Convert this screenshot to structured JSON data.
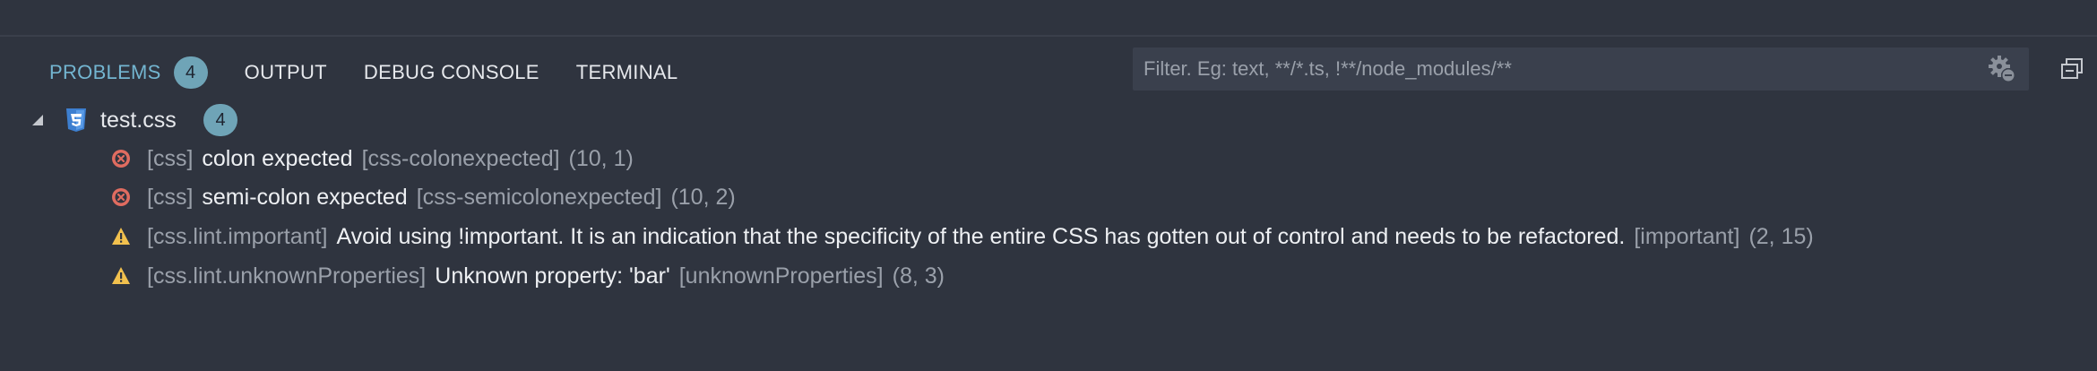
{
  "tabs": [
    {
      "label": "PROBLEMS",
      "badge": "4",
      "active": true
    },
    {
      "label": "OUTPUT"
    },
    {
      "label": "DEBUG CONSOLE"
    },
    {
      "label": "TERMINAL"
    }
  ],
  "filter": {
    "placeholder": "Filter. Eg: text, **/*.ts, !**/node_modules/**",
    "value": ""
  },
  "file": {
    "name": "test.css",
    "count": "4"
  },
  "problems": [
    {
      "severity": "error",
      "source": "[css]",
      "message": "colon expected",
      "code": "[css-colonexpected]",
      "position": "(10, 1)"
    },
    {
      "severity": "error",
      "source": "[css]",
      "message": "semi-colon expected",
      "code": "[css-semicolonexpected]",
      "position": "(10, 2)"
    },
    {
      "severity": "warning",
      "source": "[css.lint.important]",
      "message": "Avoid using !important. It is an indication that the specificity of the entire CSS has gotten out of control and needs to be refactored.",
      "code": "[important]",
      "position": "(2, 15)"
    },
    {
      "severity": "warning",
      "source": "[css.lint.unknownProperties]",
      "message": "Unknown property: 'bar'",
      "code": "[unknownProperties]",
      "position": "(8, 3)"
    }
  ],
  "colors": {
    "background": "#2f343f",
    "active_tab": "#73b5d0",
    "badge": "#6fa4b7",
    "error": "#e06c60",
    "warning": "#f2c14e"
  }
}
